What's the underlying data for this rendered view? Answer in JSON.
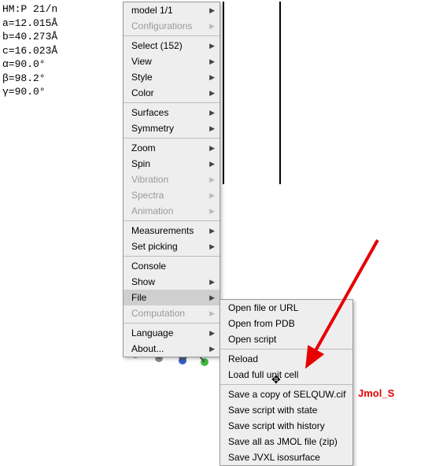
{
  "crystal": {
    "line1": "HM:P 21/n",
    "line2": "a=12.015Å",
    "line3": "b=40.273Å",
    "line4": "c=16.023Å",
    "line5": "α=90.0°",
    "line6": "β=98.2°",
    "line7": "γ=90.0°"
  },
  "menu1": {
    "model": "model 1/1",
    "configurations": "Configurations",
    "select": "Select (152)",
    "view": "View",
    "style": "Style",
    "color": "Color",
    "surfaces": "Surfaces",
    "symmetry": "Symmetry",
    "zoom": "Zoom",
    "spin": "Spin",
    "vibration": "Vibration",
    "spectra": "Spectra",
    "animation": "Animation",
    "measurements": "Measurements",
    "setpicking": "Set picking",
    "console": "Console",
    "show": "Show",
    "file": "File",
    "computation": "Computation",
    "language": "Language",
    "about": "About..."
  },
  "menu2": {
    "openfile": "Open file or URL",
    "openpdb": "Open from PDB",
    "openscript": "Open script",
    "reload": "Reload",
    "loadunitcell": "Load full unit cell",
    "savecopy": "Save a copy of SELQUW.cif",
    "savestate": "Save script with state",
    "savehistory": "Save script with history",
    "savejmol": "Save all as JMOL file (zip)",
    "savejvxl": "Save JVXL isosurface"
  },
  "annotation": {
    "label": "Jmol_S"
  }
}
